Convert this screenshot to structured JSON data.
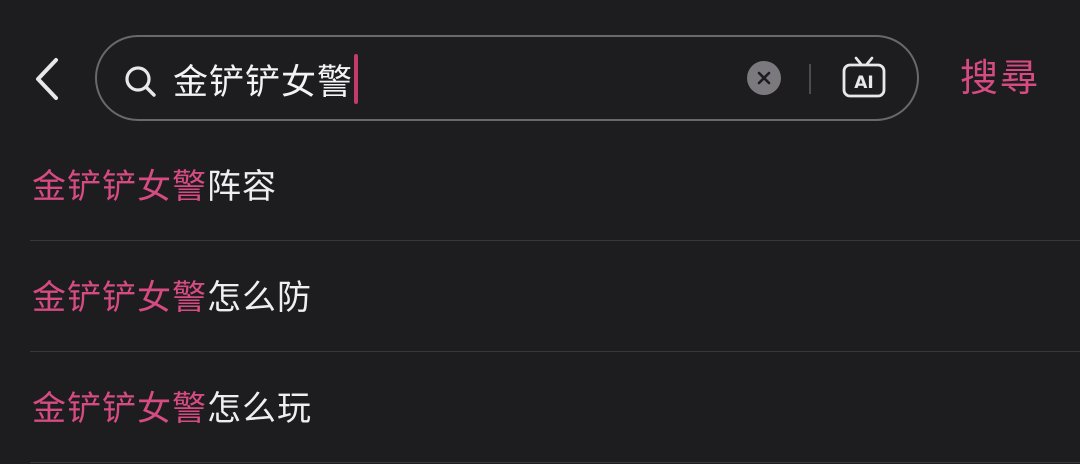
{
  "header": {
    "back_icon": "chevron-left-icon",
    "search": {
      "query": "金铲铲女警",
      "search_icon": "search-icon",
      "clear_icon": "clear-circle-icon",
      "ai_icon": "ai-tv-icon",
      "ai_icon_text": "AI"
    },
    "search_button_label": "搜尋"
  },
  "suggestions": [
    {
      "highlight": "金铲铲女警",
      "rest": "阵容"
    },
    {
      "highlight": "金铲铲女警",
      "rest": "怎么防"
    },
    {
      "highlight": "金铲铲女警",
      "rest": "怎么玩"
    }
  ],
  "colors": {
    "background": "#1d1c1f",
    "accent": "#d54b82",
    "caret": "#c33a6c",
    "text": "#efefef",
    "border": "#6a686d",
    "separator": "#38363b"
  }
}
